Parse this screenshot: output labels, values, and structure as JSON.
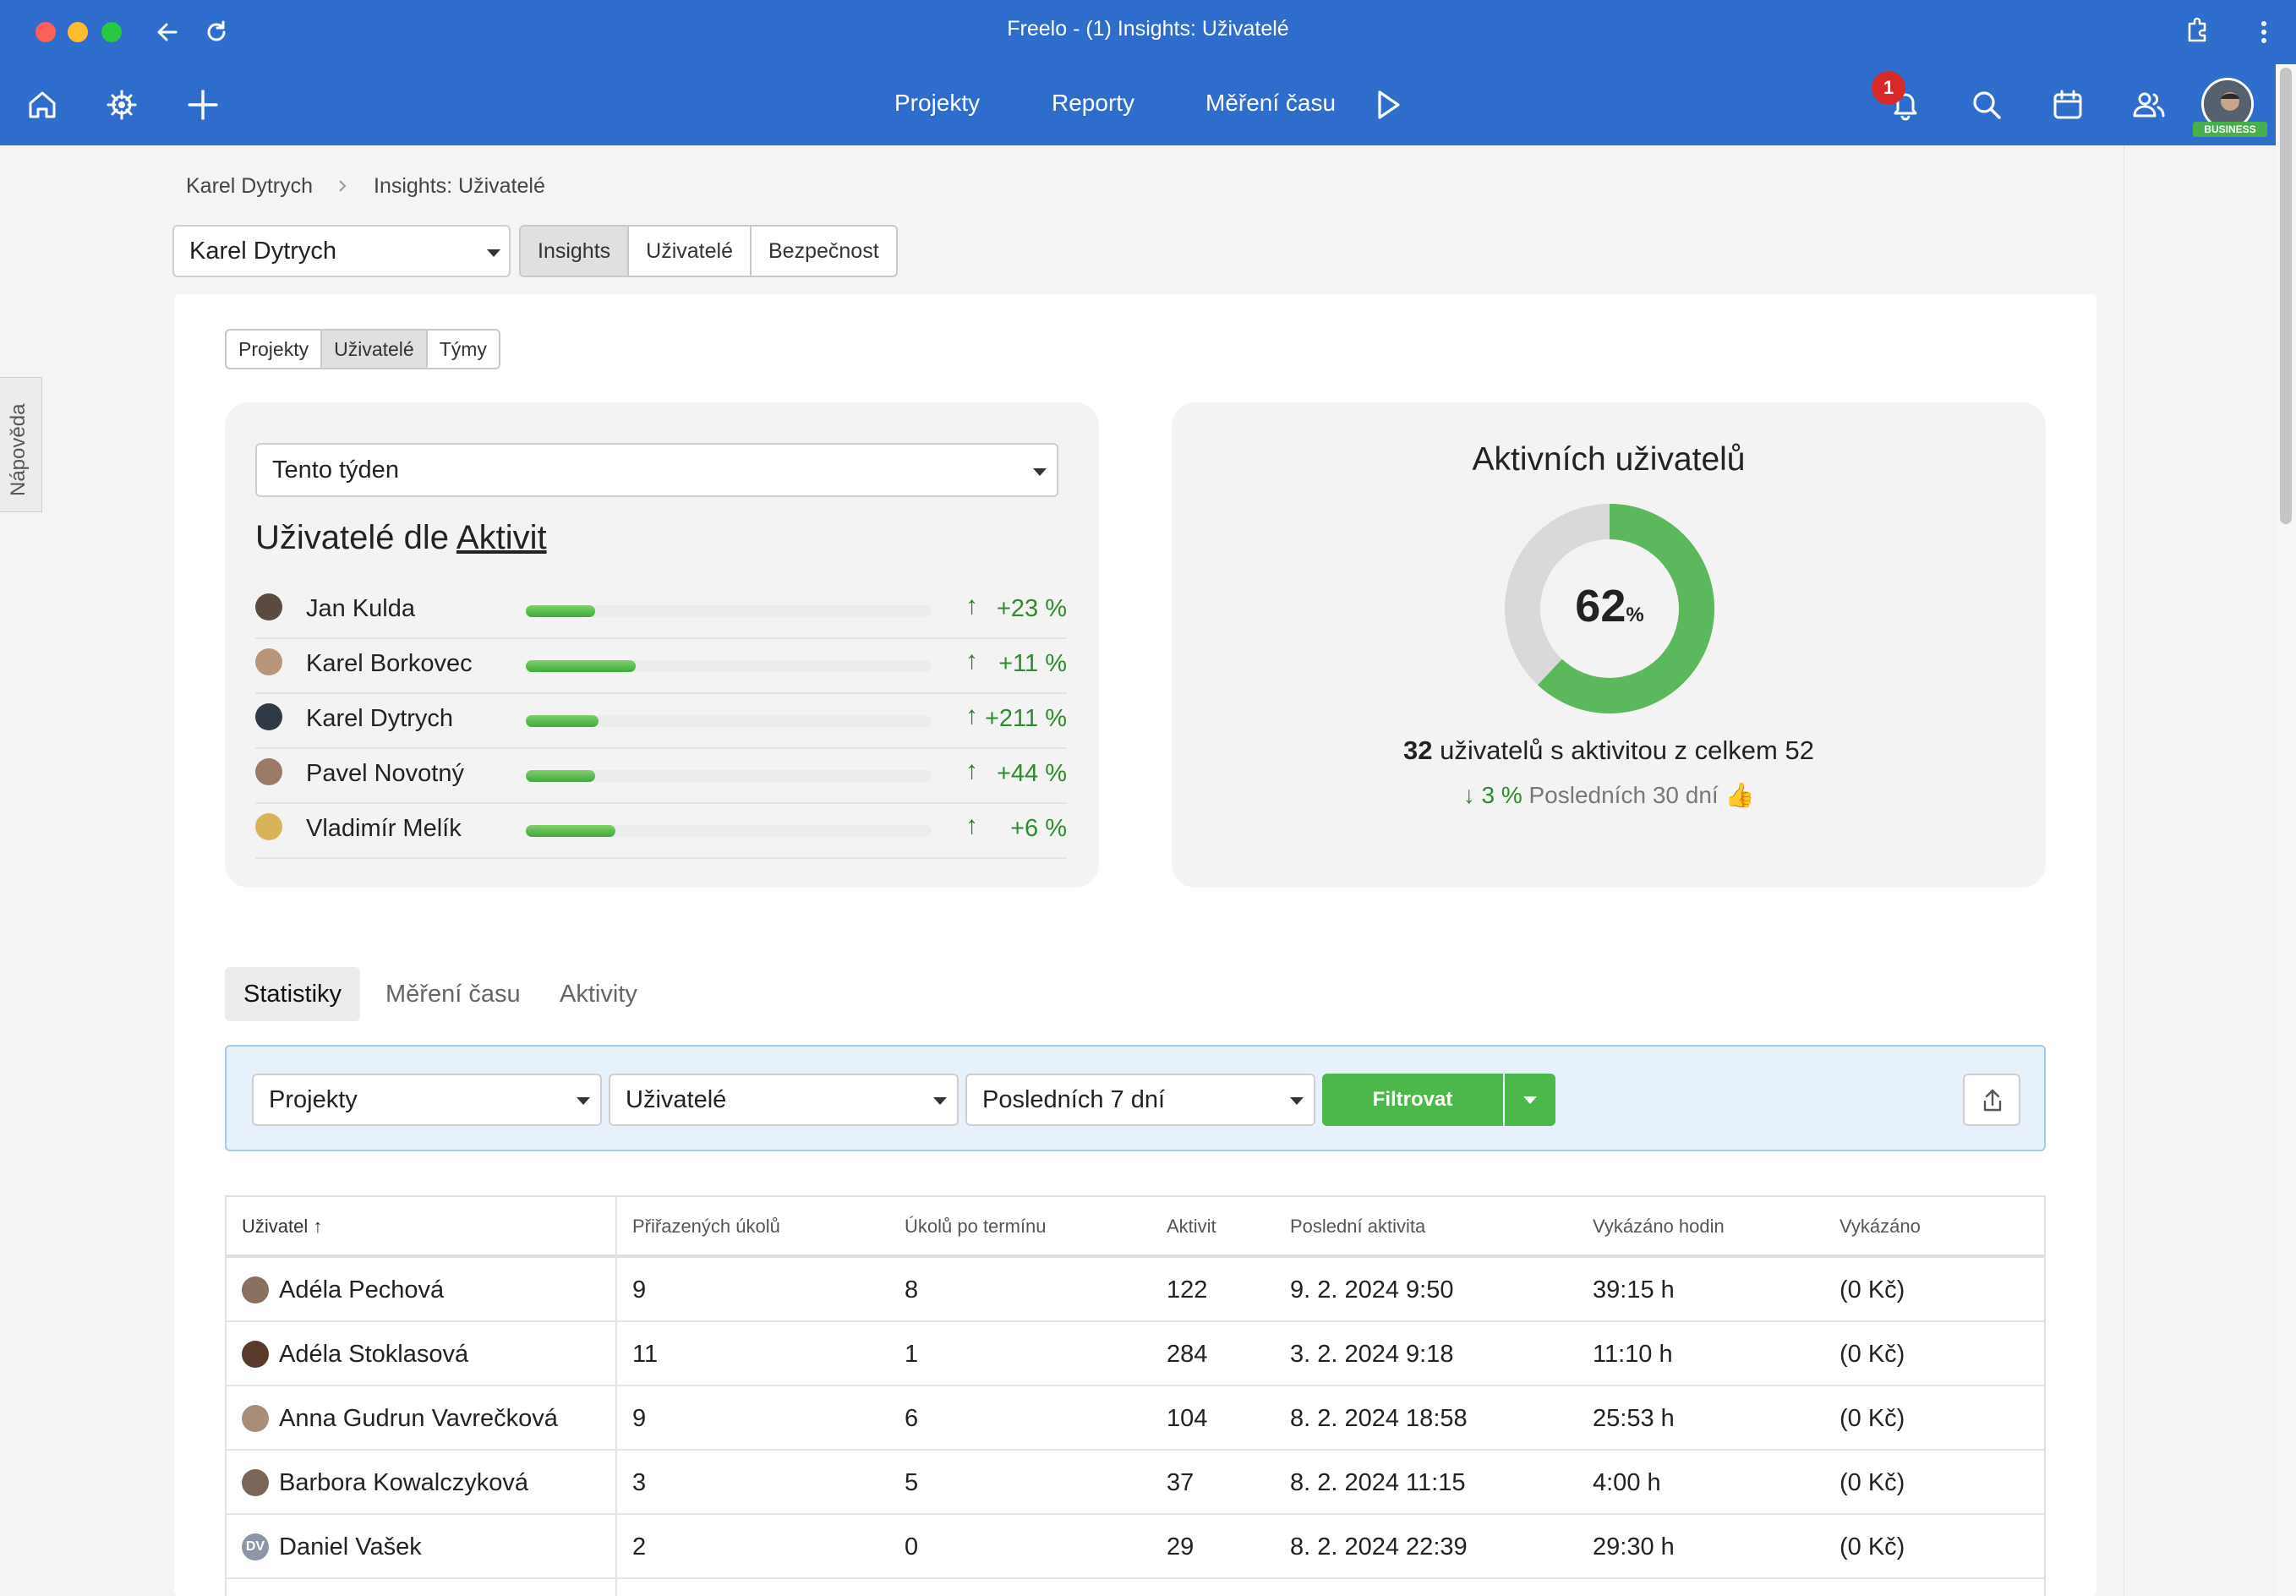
{
  "window": {
    "title": "Freelo - (1) Insights: Uživatelé"
  },
  "nav": {
    "links": [
      "Projekty",
      "Reporty",
      "Měření času"
    ],
    "notification_count": "1",
    "plan_badge": "BUSINESS"
  },
  "help_tab": "Nápověda",
  "breadcrumb": {
    "items": [
      "Karel Dytrych",
      "Insights: Uživatelé"
    ]
  },
  "workspace_select": {
    "value": "Karel Dytrych"
  },
  "main_tabs": [
    "Insights",
    "Uživatelé",
    "Bezpečnost"
  ],
  "sub_tabs": [
    "Projekty",
    "Uživatelé",
    "Týmy"
  ],
  "activity_panel": {
    "period": "Tento týden",
    "title_prefix": "Uživatelé dle",
    "title_link": "Aktivit",
    "users": [
      {
        "name": "Jan Kulda",
        "bar": 0.17,
        "change": "+23 %"
      },
      {
        "name": "Karel Borkovec",
        "bar": 0.27,
        "change": "+11 %"
      },
      {
        "name": "Karel Dytrych",
        "bar": 0.18,
        "change": "+211 %"
      },
      {
        "name": "Pavel Novotný",
        "bar": 0.17,
        "change": "+44 %"
      },
      {
        "name": "Vladimír Melík",
        "bar": 0.22,
        "change": "+6 %"
      }
    ]
  },
  "active_panel": {
    "title": "Aktivních uživatelů",
    "percent": "62",
    "percent_unit": "%",
    "percent_value": 0.62,
    "summary_count": "32",
    "summary_text": "uživatelů s aktivitou z celkem 52",
    "trend_value": "3 %",
    "trend_label": "Posledních 30 dní 👍",
    "colors": {
      "active": "#5cb85c",
      "inactive": "#d9d9d9"
    }
  },
  "section_tabs": [
    "Statistiky",
    "Měření času",
    "Aktivity"
  ],
  "filters": {
    "projects": "Projekty",
    "users": "Uživatelé",
    "period": "Posledních 7 dní",
    "button": "Filtrovat"
  },
  "table": {
    "columns": [
      "Uživatel ↑",
      "Přiřazených úkolů",
      "Úkolů po termínu",
      "Aktivit",
      "Poslední aktivita",
      "Vykázáno hodin",
      "Vykázáno"
    ],
    "rows": [
      {
        "avatar": "",
        "name": "Adéla Pechová",
        "assigned": "9",
        "overdue": "8",
        "activities": "122",
        "last": "9. 2. 2024 9:50",
        "hours": "39:15 h",
        "amount": "(0 Kč)"
      },
      {
        "avatar": "",
        "name": "Adéla Stoklasová",
        "assigned": "11",
        "overdue": "1",
        "activities": "284",
        "last": "3. 2. 2024 9:18",
        "hours": "11:10 h",
        "amount": "(0 Kč)"
      },
      {
        "avatar": "",
        "name": "Anna Gudrun Vavrečková",
        "assigned": "9",
        "overdue": "6",
        "activities": "104",
        "last": "8. 2. 2024 18:58",
        "hours": "25:53 h",
        "amount": "(0 Kč)"
      },
      {
        "avatar": "",
        "name": "Barbora Kowalczyková",
        "assigned": "3",
        "overdue": "5",
        "activities": "37",
        "last": "8. 2. 2024 11:15",
        "hours": "4:00 h",
        "amount": "(0 Kč)"
      },
      {
        "avatar": "DV",
        "name": "Daniel Vašek",
        "assigned": "2",
        "overdue": "0",
        "activities": "29",
        "last": "8. 2. 2024 22:39",
        "hours": "29:30 h",
        "amount": "(0 Kč)"
      }
    ]
  }
}
